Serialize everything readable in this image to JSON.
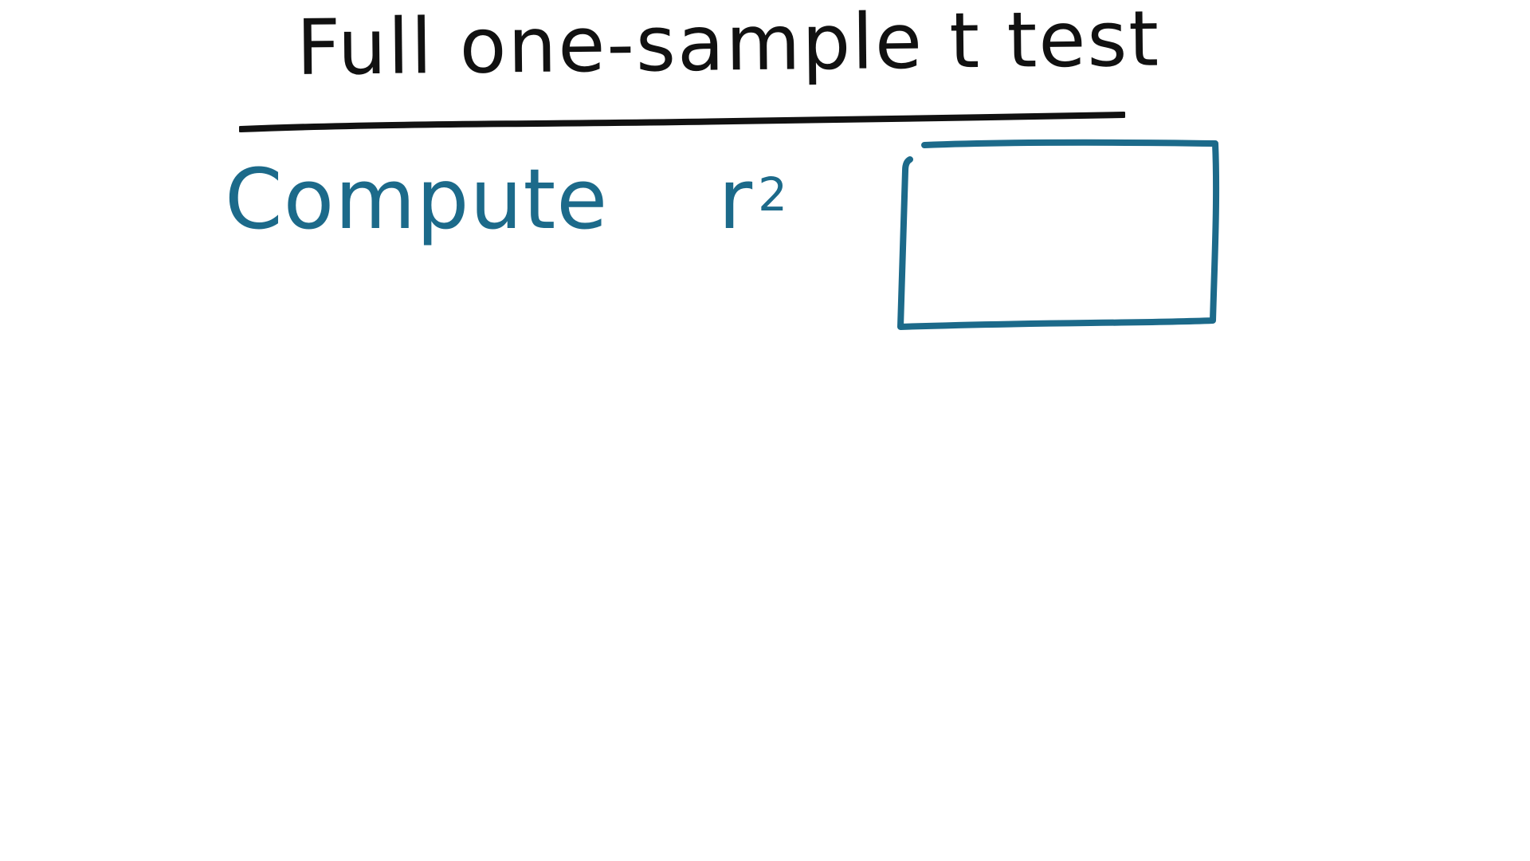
{
  "slide": {
    "title": "Full one-sample t test",
    "prompt_word": "Compute",
    "prompt_symbol": "r",
    "prompt_exponent": "2",
    "answer_value": ""
  },
  "colors": {
    "ink_black": "#111111",
    "ink_teal": "#1c6a8a",
    "background": "#ffffff"
  }
}
